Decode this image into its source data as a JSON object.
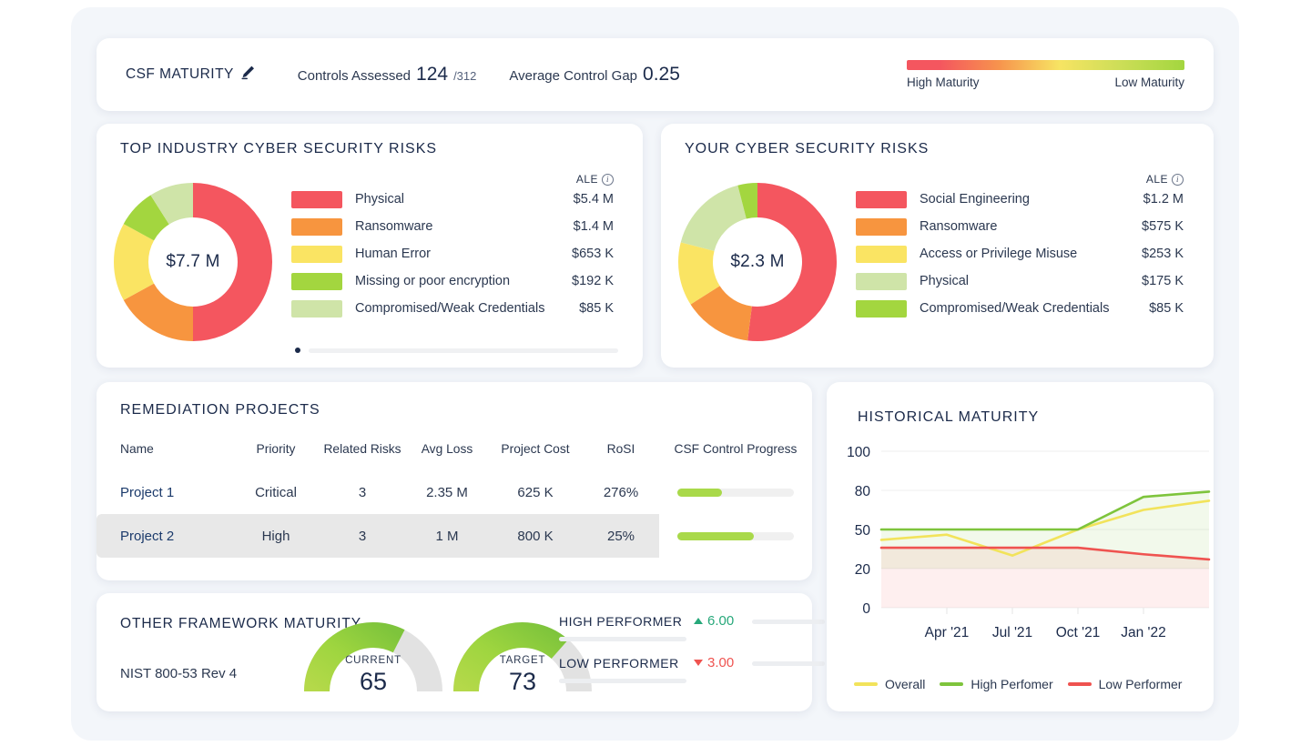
{
  "header": {
    "title": "CSF MATURITY",
    "edit_icon": "pencil-icon",
    "controls_assessed_label": "Controls Assessed",
    "controls_assessed_value": "124",
    "controls_assessed_total": "/312",
    "avg_gap_label": "Average Control Gap",
    "avg_gap_value": "0.25",
    "legend_high": "High Maturity",
    "legend_low": "Low Maturity"
  },
  "industry_risks": {
    "title": "TOP INDUSTRY CYBER SECURITY RISKS",
    "center_value": "$7.7 M",
    "ale_header": "ALE",
    "info_icon": "info-icon",
    "items": [
      {
        "label": "Physical",
        "value": "$5.4 M",
        "color": "#f4565f",
        "pct": 50
      },
      {
        "label": "Ransomware",
        "value": "$1.4 M",
        "color": "#f7953f",
        "pct": 17
      },
      {
        "label": "Human Error",
        "value": "$653 K",
        "color": "#fae463",
        "pct": 16
      },
      {
        "label": "Missing or poor encryption",
        "value": "$192 K",
        "color": "#a3d63f",
        "pct": 8
      },
      {
        "label": "Compromised/Weak Credentials",
        "value": "$85 K",
        "color": "#cfe4a8",
        "pct": 9
      }
    ]
  },
  "your_risks": {
    "title": "YOUR CYBER SECURITY RISKS",
    "center_value": "$2.3 M",
    "ale_header": "ALE",
    "info_icon": "info-icon",
    "items": [
      {
        "label": "Social Engineering",
        "value": "$1.2 M",
        "color": "#f4565f",
        "pct": 52
      },
      {
        "label": "Ransomware",
        "value": "$575 K",
        "color": "#f7953f",
        "pct": 14
      },
      {
        "label": "Access or Privilege Misuse",
        "value": "$253 K",
        "color": "#fae463",
        "pct": 13
      },
      {
        "label": "Physical",
        "value": "$175 K",
        "color": "#cfe4a8",
        "pct": 17
      },
      {
        "label": "Compromised/Weak Credentials",
        "value": "$85 K",
        "color": "#a3d63f",
        "pct": 4
      }
    ]
  },
  "remediation": {
    "title": "REMEDIATION PROJECTS",
    "columns": [
      "Name",
      "Priority",
      "Related Risks",
      "Avg Loss",
      "Project Cost",
      "RoSI",
      "CSF Control Progress"
    ],
    "rows": [
      {
        "name": "Project 1",
        "priority": "Critical",
        "related_risks": "3",
        "avg_loss": "2.35 M",
        "project_cost": "625 K",
        "rosi": "276%",
        "progress": 38
      },
      {
        "name": "Project 2",
        "priority": "High",
        "related_risks": "3",
        "avg_loss": "1 M",
        "project_cost": "800 K",
        "rosi": "25%",
        "progress": 66
      }
    ]
  },
  "framework": {
    "title": "OTHER FRAMEWORK MATURITY",
    "subtitle": "NIST 800-53 Rev 4",
    "gauges": [
      {
        "caption": "CURRENT",
        "value": "65",
        "pct": 65
      },
      {
        "caption": "TARGET",
        "value": "73",
        "pct": 73
      }
    ],
    "performers": [
      {
        "label": "HIGH PERFORMER",
        "value": "6.00",
        "direction": "up",
        "color": "#27a87a"
      },
      {
        "label": "LOW PERFORMER",
        "value": "3.00",
        "direction": "down",
        "color": "#ef5350"
      }
    ]
  },
  "chart_data": {
    "type": "line",
    "title": "HISTORICAL MATURITY",
    "xlabel": "",
    "ylabel": "",
    "x": [
      "Apr '21",
      "Jul '21",
      "Oct '21",
      "Jan '22"
    ],
    "tick_labels": [
      "100",
      "80",
      "50",
      "20",
      "0"
    ],
    "tick_values": [
      100,
      80,
      50,
      20,
      0
    ],
    "ylim": [
      0,
      100
    ],
    "grid": true,
    "legend_position": "bottom",
    "series": [
      {
        "name": "Overall",
        "color": "#f2e35b",
        "values": [
          42,
          46,
          30,
          50,
          65,
          72
        ]
      },
      {
        "name": "High Perfomer",
        "color": "#7ec43c",
        "values": [
          50,
          50,
          50,
          50,
          75,
          79
        ]
      },
      {
        "name": "Low Performer",
        "color": "#ef5350",
        "values": [
          36,
          36,
          36,
          36,
          31,
          27
        ]
      }
    ]
  }
}
